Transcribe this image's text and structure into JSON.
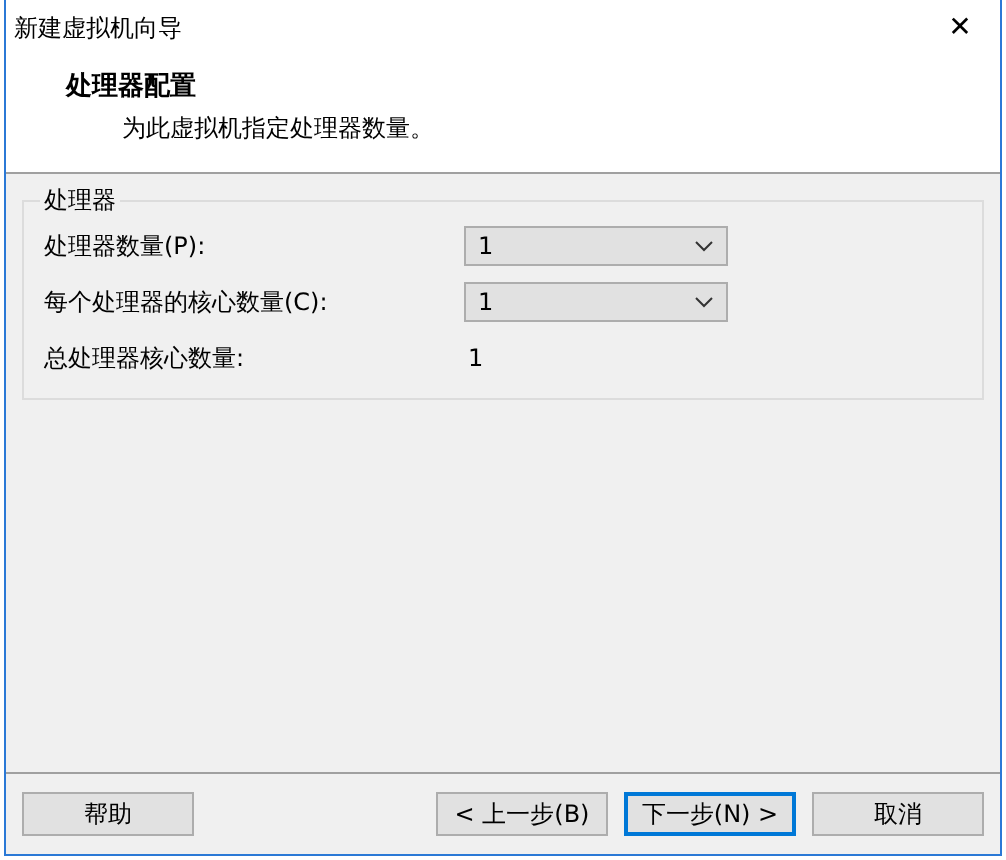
{
  "window": {
    "title": "新建虚拟机向导",
    "close": "✕"
  },
  "header": {
    "title": "处理器配置",
    "subtitle": "为此虚拟机指定处理器数量。"
  },
  "group": {
    "title": "处理器",
    "rows": [
      {
        "kind": "dropdown",
        "label": "处理器数量(P):",
        "value": "1"
      },
      {
        "kind": "dropdown",
        "label": "每个处理器的核心数量(C):",
        "value": "1"
      },
      {
        "kind": "text",
        "label": "总处理器核心数量:",
        "value": "1"
      }
    ]
  },
  "buttons": [
    {
      "label": "帮助",
      "kind": "help",
      "focused": false
    },
    {
      "label": "< 上一步(B)",
      "kind": "nav",
      "focused": false
    },
    {
      "label": "下一步(N) >",
      "kind": "nav",
      "focused": true
    },
    {
      "label": "取消",
      "kind": "nav",
      "focused": false
    }
  ]
}
